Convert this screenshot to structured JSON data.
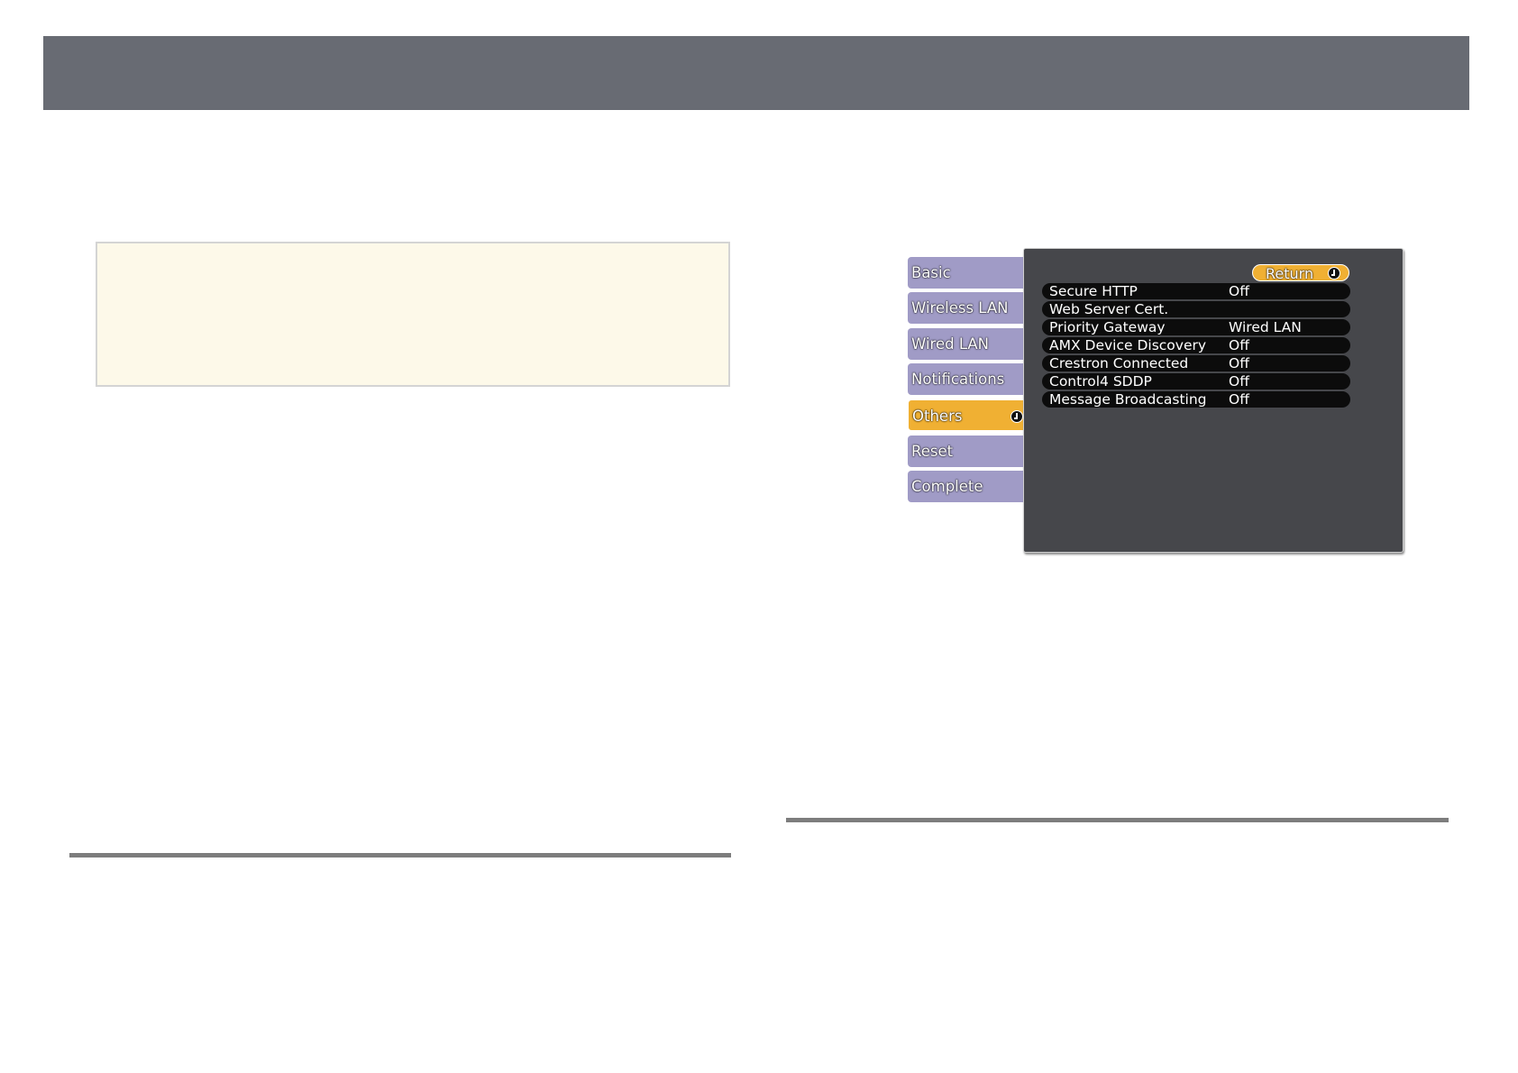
{
  "menu": {
    "tabs": [
      {
        "label": "Basic"
      },
      {
        "label": "Wireless LAN"
      },
      {
        "label": "Wired LAN"
      },
      {
        "label": "Notifications"
      },
      {
        "label": "Others"
      },
      {
        "label": "Reset"
      },
      {
        "label": "Complete"
      }
    ],
    "active_tab": "Others",
    "return_label": "Return",
    "settings": [
      {
        "label": "Secure HTTP",
        "value": "Off"
      },
      {
        "label": "Web Server Cert.",
        "value": ""
      },
      {
        "label": "Priority Gateway",
        "value": "Wired LAN"
      },
      {
        "label": "AMX Device Discovery",
        "value": "Off"
      },
      {
        "label": "Crestron Connected",
        "value": "Off"
      },
      {
        "label": "Control4 SDDP",
        "value": "Off"
      },
      {
        "label": "Message Broadcasting",
        "value": "Off"
      }
    ]
  },
  "colors": {
    "header": "#686b73",
    "note_background": "#fdf9e9",
    "tab": "#a09bc6",
    "tab_active": "#f0b033",
    "panel": "#46474b",
    "row": "#0c0c0c"
  }
}
